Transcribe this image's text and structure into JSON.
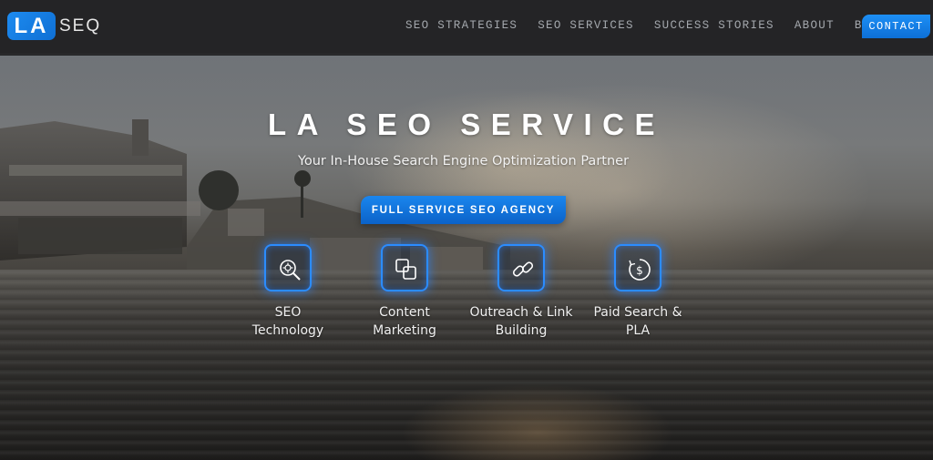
{
  "header": {
    "logo_mark": "LA",
    "logo_text": "SEQ",
    "nav": [
      {
        "label": "SEO STRATEGIES"
      },
      {
        "label": "SEO SERVICES"
      },
      {
        "label": "SUCCESS STORIES"
      },
      {
        "label": "ABOUT"
      },
      {
        "label": "BLOG"
      }
    ],
    "contact_label": "CONTACT"
  },
  "hero": {
    "title": "LA SEO SERVICE",
    "subtitle": "Your In-House Search Engine Optimization Partner",
    "cta_label": "FULL SERVICE SEO AGENCY",
    "services": [
      {
        "line1": "SEO",
        "line2": "Technology",
        "icon": "magnifier-gear-icon"
      },
      {
        "line1": "Content",
        "line2": "Marketing",
        "icon": "content-squares-icon"
      },
      {
        "line1": "Outreach & Link",
        "line2": "Building",
        "icon": "chain-link-icon"
      },
      {
        "line1": "Paid Search &",
        "line2": "PLA",
        "icon": "dollar-cycle-icon"
      }
    ]
  },
  "colors": {
    "accent": "#1a86ee",
    "header_bg": "#242426",
    "nav_text": "#a4a8ad"
  }
}
